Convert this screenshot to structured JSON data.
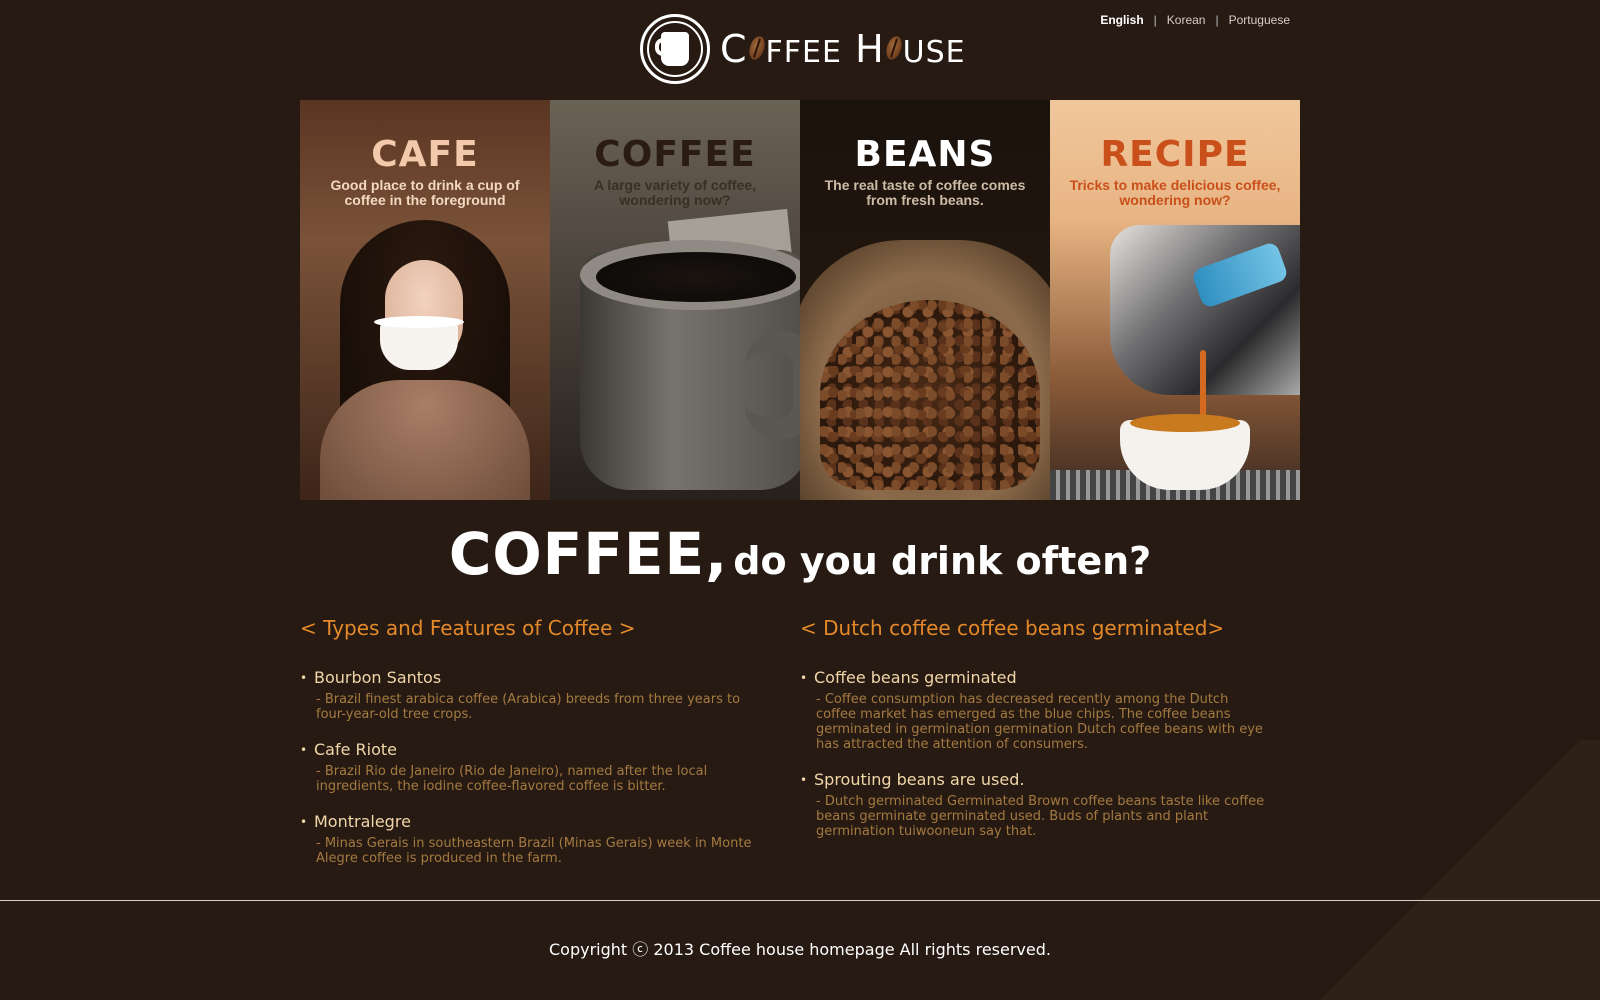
{
  "header": {
    "logo": {
      "word1_first": "C",
      "word1_rest": "FFEE",
      "word2_first": "H",
      "word2_rest": "USE"
    },
    "languages": [
      {
        "label": "English",
        "active": true
      },
      {
        "label": "Korean",
        "active": false
      },
      {
        "label": "Portuguese",
        "active": false
      }
    ],
    "separator": "|"
  },
  "panels": [
    {
      "title": "CAFE",
      "subtitle": "Good place to drink a cup of coffee in the foreground",
      "title_color": "#f2c9aa"
    },
    {
      "title": "COFFEE",
      "subtitle": "A large variety of coffee, wondering now?",
      "title_color": "#2a1c12"
    },
    {
      "title": "BEANS",
      "subtitle": "The real taste of coffee comes from fresh beans.",
      "title_color": "#ffffff"
    },
    {
      "title": "RECIPE",
      "subtitle": "Tricks to make delicious coffee, wondering now?",
      "title_color": "#c9501b"
    }
  ],
  "headline": {
    "big": "COFFEE,",
    "small": "do you drink often?"
  },
  "left_column": {
    "heading": "< Types and Features of Coffee >",
    "items": [
      {
        "title": "Bourbon Santos",
        "desc": "- Brazil finest arabica coffee (Arabica) breeds from three years to four-year-old tree crops."
      },
      {
        "title": "Cafe Riote",
        "desc": "- Brazil Rio de Janeiro (Rio de Janeiro), named after the local ingredients, the iodine coffee-flavored coffee is bitter."
      },
      {
        "title": "Montralegre",
        "desc": "- Minas Gerais in southeastern Brazil (Minas Gerais) week in Monte Alegre coffee is produced in the farm."
      }
    ]
  },
  "right_column": {
    "heading": "< Dutch coffee coffee beans germinated>",
    "items": [
      {
        "title": "Coffee beans germinated",
        "desc": "- Coffee consumption has decreased recently among the Dutch coffee market has emerged as the blue chips. The coffee beans germinated in germination germination Dutch coffee beans with eye has attracted the attention of consumers."
      },
      {
        "title": "Sprouting beans are used.",
        "desc": "- Dutch germinated Germinated Brown coffee beans taste like coffee beans germinate germinated used. Buds of plants and plant germination tuiwooneun say that."
      }
    ]
  },
  "footer": {
    "copyright": "Copyright ⓒ 2013 Coffee house homepage All rights reserved."
  },
  "colors": {
    "background": "#261a12",
    "accent": "#e4892a",
    "item_title": "#f1d6a8",
    "item_desc": "#a47a40"
  },
  "icons": {
    "logo": "coffee-cup-icon",
    "bean": "coffee-bean-icon"
  }
}
